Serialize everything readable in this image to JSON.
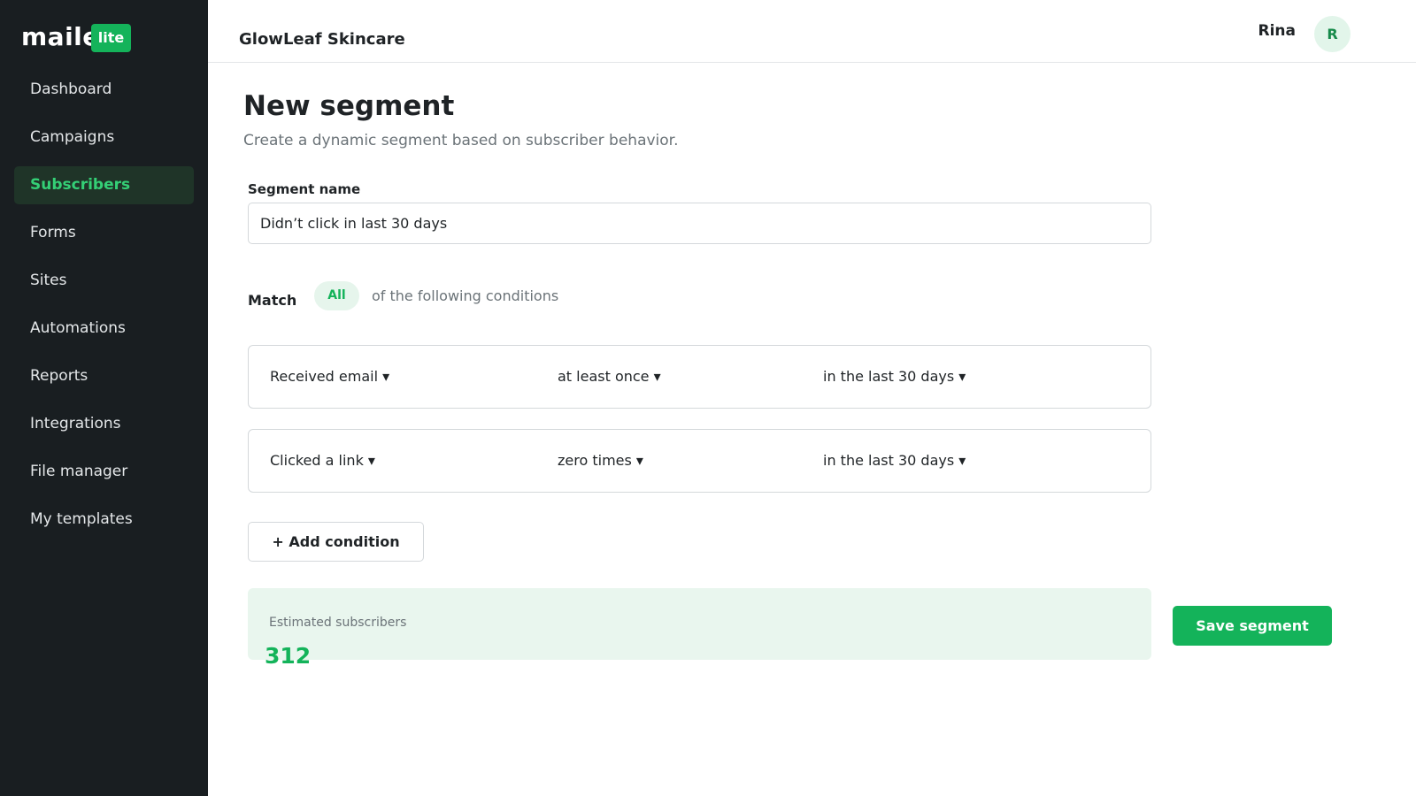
{
  "logo": {
    "word": "maile",
    "badge": "lite"
  },
  "sidebar": {
    "items": [
      {
        "label": "Dashboard",
        "active": false
      },
      {
        "label": "Campaigns",
        "active": false
      },
      {
        "label": "Subscribers",
        "active": true
      },
      {
        "label": "Forms",
        "active": false
      },
      {
        "label": "Sites",
        "active": false
      },
      {
        "label": "Automations",
        "active": false
      },
      {
        "label": "Reports",
        "active": false
      },
      {
        "label": "Integrations",
        "active": false
      },
      {
        "label": "File manager",
        "active": false
      },
      {
        "label": "My templates",
        "active": false
      }
    ]
  },
  "header": {
    "account_name": "GlowLeaf Skincare",
    "user_name": "Rina",
    "avatar_initial": "R"
  },
  "page": {
    "title": "New segment",
    "subtitle": "Create a dynamic segment based on subscriber behavior."
  },
  "form": {
    "segment_name_label": "Segment name",
    "segment_name_value": "Didn’t click in last 30 days",
    "match_label": "Match",
    "match_value": "All",
    "match_suffix": "of the following conditions",
    "conditions": [
      {
        "field": "Received email ▾",
        "operator": "at least once ▾",
        "timeframe": "in the last 30 days ▾"
      },
      {
        "field": "Clicked a link ▾",
        "operator": "zero times ▾",
        "timeframe": "in the last 30 days ▾"
      }
    ],
    "add_condition_label": "+ Add condition"
  },
  "estimate": {
    "label": "Estimated subscribers",
    "value": "312"
  },
  "actions": {
    "save_label": "Save segment"
  },
  "colors": {
    "sidebar_bg": "#191e21",
    "brand_green": "#14b35a",
    "active_nav_text": "#34cf76",
    "estimate_bg": "#e9f6ee"
  }
}
